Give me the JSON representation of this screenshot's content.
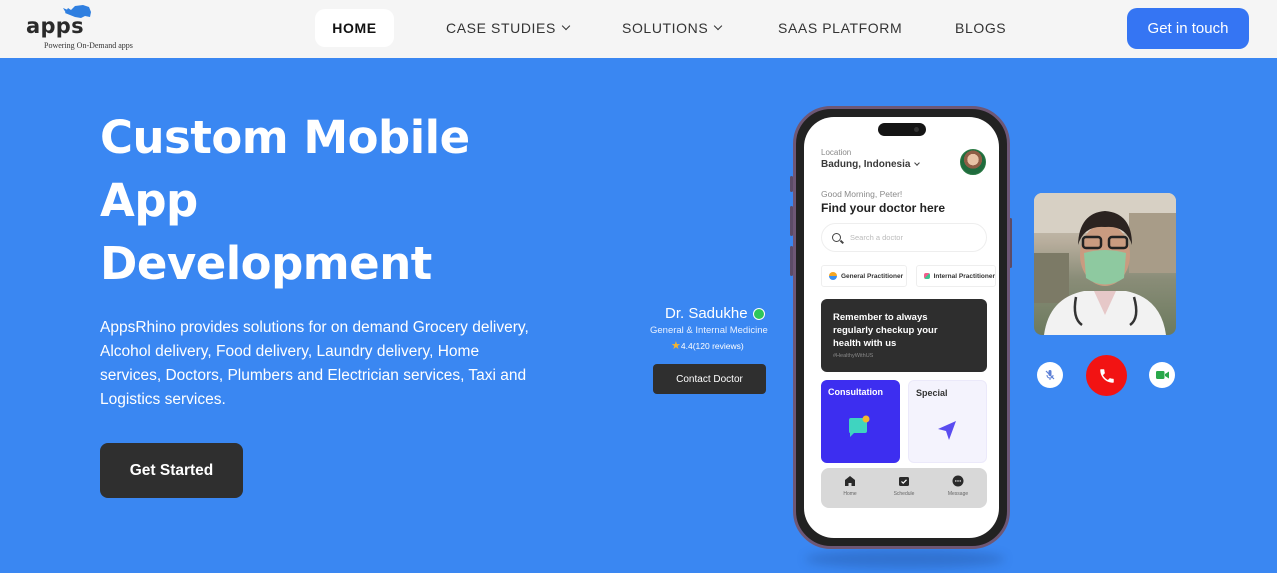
{
  "header": {
    "logo": {
      "text": "apps",
      "tagline": "Powering On-Demand apps",
      "icon": "rhino-icon",
      "icon_color": "#2f7fe0"
    },
    "nav": [
      {
        "label": "HOME",
        "active": true,
        "dropdown": false
      },
      {
        "label": "CASE STUDIES",
        "active": false,
        "dropdown": true
      },
      {
        "label": "SOLUTIONS",
        "active": false,
        "dropdown": true
      },
      {
        "label": "SAAS PLATFORM",
        "active": false,
        "dropdown": false
      },
      {
        "label": "BLOGS",
        "active": false,
        "dropdown": false
      }
    ],
    "cta_label": "Get in touch"
  },
  "hero": {
    "title_lines": [
      "Custom Mobile",
      "App",
      "Development"
    ],
    "description": "AppsRhino provides solutions for on demand Grocery delivery, Alcohol delivery, Food delivery, Laundry delivery, Home services, Doctors, Plumbers and Electrician services, Taxi and Logistics services.",
    "button_label": "Get Started"
  },
  "doctor_card": {
    "name": "Dr. Sadukhe",
    "status": "online",
    "specialty": "General & Internal Medicine",
    "rating": "4.4",
    "reviews": "(120 reviews)",
    "contact_label": "Contact Doctor"
  },
  "phone_app": {
    "location_label": "Location",
    "location_value": "Badung, Indonesia",
    "greeting": "Good Morning, Peter!",
    "heading": "Find your doctor here",
    "search_placeholder": "Search a doctor",
    "chips": [
      "General Practitioner",
      "Internal Practitioner"
    ],
    "banner": {
      "text": "Remember to always regularly checkup your health with us",
      "tag": "#HealthyWithUS"
    },
    "cards": [
      {
        "label": "Consultation",
        "icon": "chat-icon"
      },
      {
        "label": "Special",
        "icon": "send-icon"
      }
    ],
    "bottom_nav": [
      {
        "label": "Home",
        "icon": "home-icon"
      },
      {
        "label": "Schedule",
        "icon": "calendar-check-icon"
      },
      {
        "label": "Message",
        "icon": "message-icon"
      }
    ]
  },
  "video_call": {
    "controls": [
      {
        "name": "mute",
        "icon": "mic-off-icon"
      },
      {
        "name": "end-call",
        "icon": "phone-icon",
        "color": "#f21313"
      },
      {
        "name": "camera",
        "icon": "video-icon",
        "color": "#2aa84a"
      }
    ]
  },
  "colors": {
    "hero_bg": "#3a87f2",
    "header_bg": "#f5f5f5",
    "cta_bg": "#3575f3",
    "dark_button": "#2f2f2f",
    "consult_card": "#3d2ef0"
  }
}
